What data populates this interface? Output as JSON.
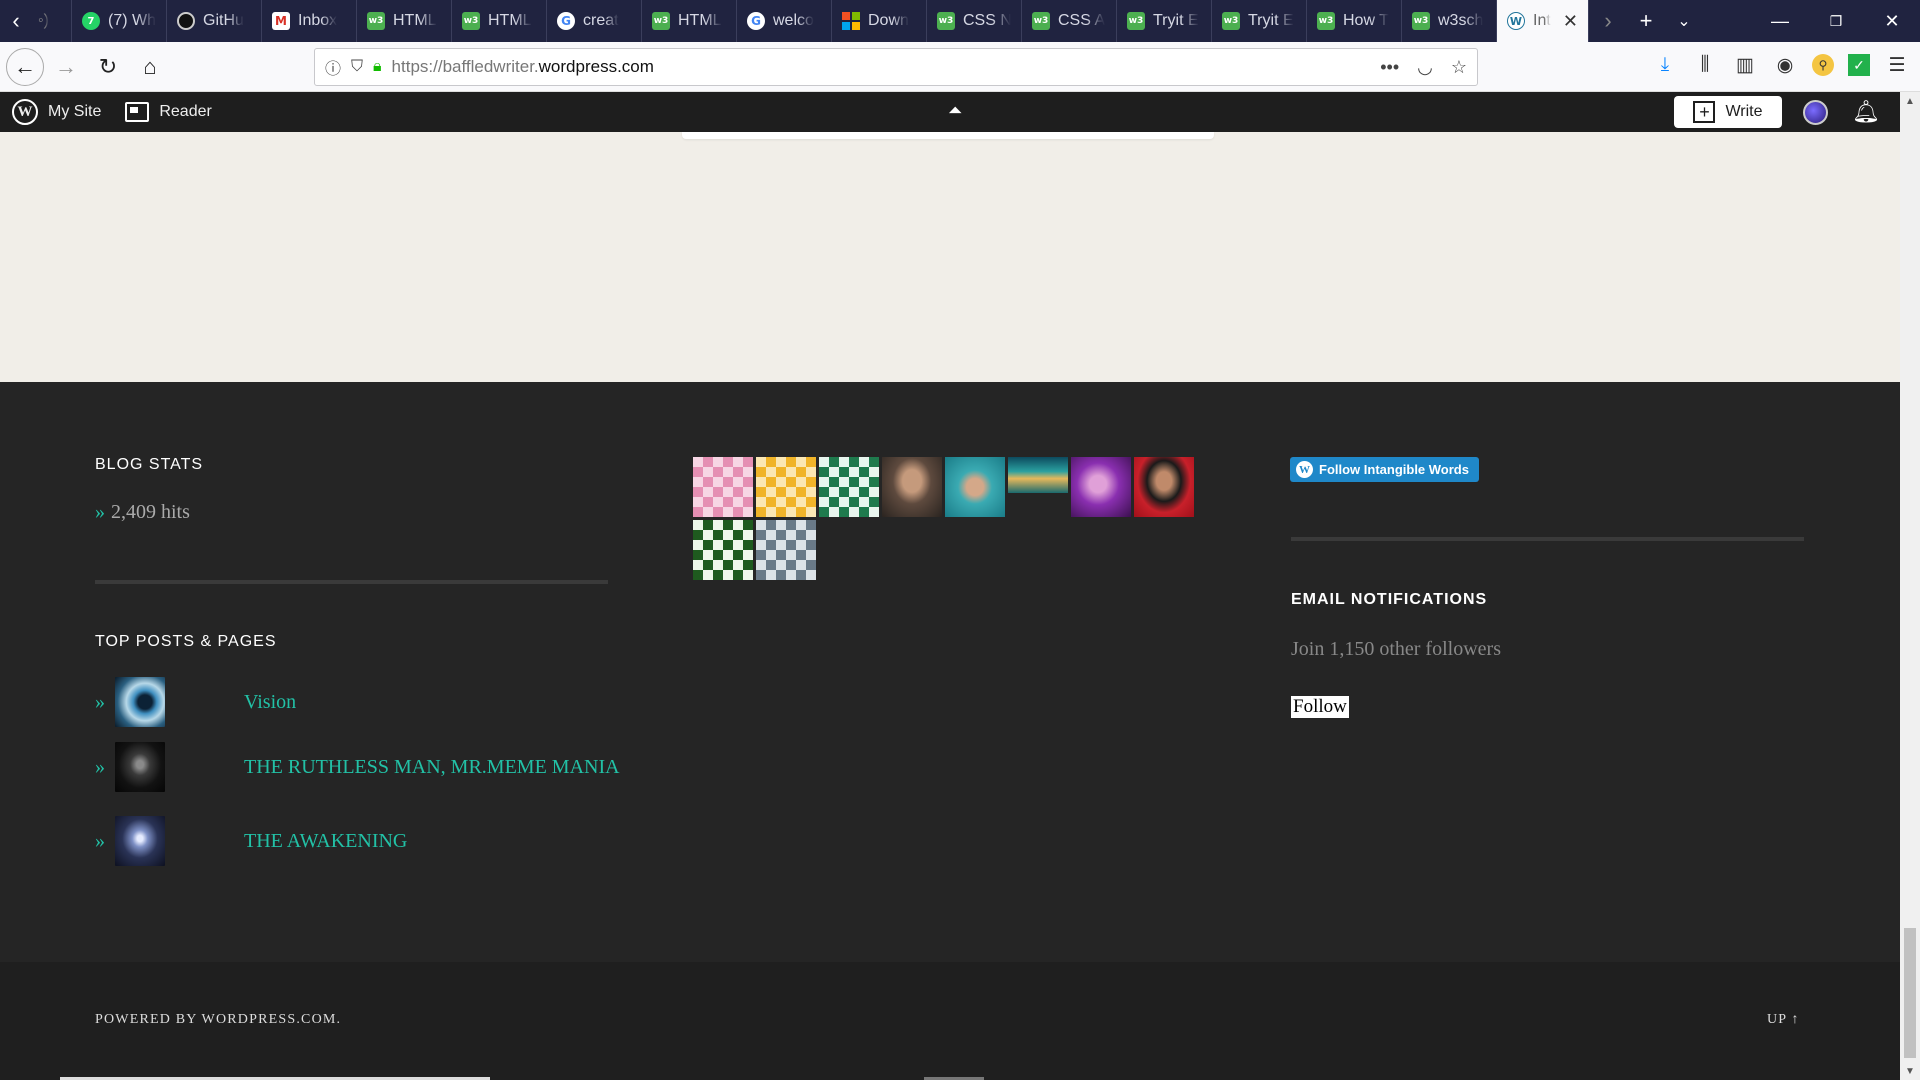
{
  "browser": {
    "tabs": [
      {
        "label": "(7) Wh",
        "icon": "whatsapp-icon"
      },
      {
        "label": "GitHu",
        "icon": "github-icon"
      },
      {
        "label": "Inbox",
        "icon": "gmail-icon"
      },
      {
        "label": "HTML",
        "icon": "w3schools-icon"
      },
      {
        "label": "HTML",
        "icon": "w3schools-icon"
      },
      {
        "label": "creat",
        "icon": "google-icon"
      },
      {
        "label": "HTML",
        "icon": "w3schools-icon"
      },
      {
        "label": "welco",
        "icon": "google-icon"
      },
      {
        "label": "Down",
        "icon": "microsoft-icon"
      },
      {
        "label": "CSS N",
        "icon": "w3schools-icon"
      },
      {
        "label": "CSS A",
        "icon": "w3schools-icon"
      },
      {
        "label": "Tryit E",
        "icon": "w3schools-icon"
      },
      {
        "label": "Tryit E",
        "icon": "w3schools-icon"
      },
      {
        "label": "How T",
        "icon": "w3schools-icon"
      },
      {
        "label": "w3sch",
        "icon": "w3schools-icon"
      },
      {
        "label": "Int",
        "icon": "wordpress-icon",
        "active": true
      }
    ],
    "url_prefix": "https://baffledwriter.",
    "url_domain": "wordpress.com"
  },
  "admin_bar": {
    "my_site": "My Site",
    "reader": "Reader",
    "write": "Write"
  },
  "widgets": {
    "blog_stats": {
      "title": "BLOG STATS",
      "raquo": "»",
      "hits": "2,409 hits"
    },
    "top_posts": {
      "title": "TOP POSTS & PAGES",
      "items": [
        {
          "title": "Vision"
        },
        {
          "title": "THE RUTHLESS MAN, MR.MEME MANIA"
        },
        {
          "title": "THE AWAKENING"
        }
      ]
    },
    "follow_badge": "Follow Intangible Words",
    "email": {
      "title": "EMAIL NOTIFICATIONS",
      "followers": "Join 1,150 other followers",
      "button": "Follow"
    }
  },
  "site_info": {
    "powered": "POWERED BY WORDPRESS.COM.",
    "up": "UP ↑"
  }
}
